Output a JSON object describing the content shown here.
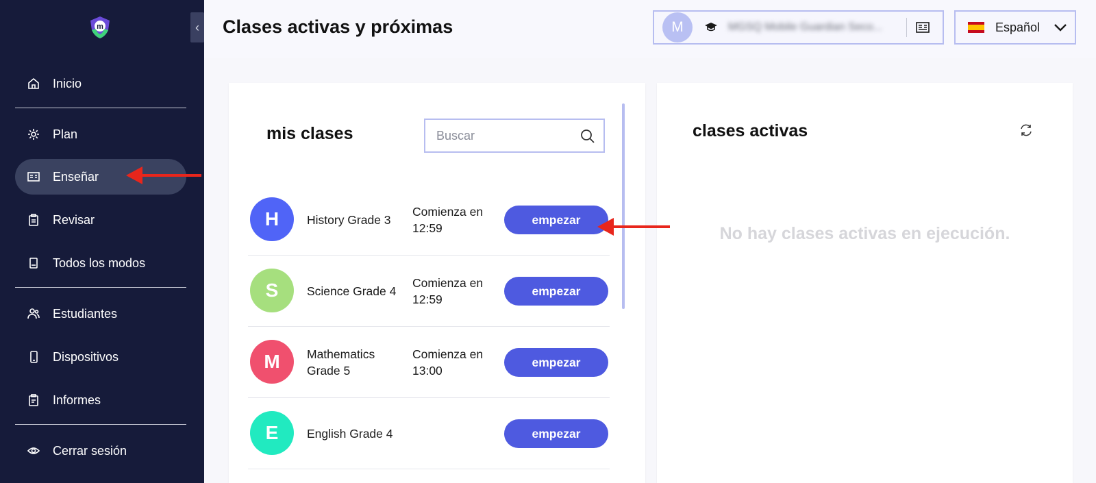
{
  "header": {
    "title": "Clases activas y próximas",
    "user": {
      "avatar_letter": "M",
      "school": "MGSQ Mobile Guardian Seco...",
      "cap_icon": "graduation-cap-icon",
      "id_icon": "id-card-icon"
    },
    "language": {
      "label": "Español",
      "flag": "spain-flag",
      "chevron": "chevron-down-icon"
    }
  },
  "sidebar": {
    "collapse_icon": "‹",
    "items": [
      {
        "label": "Inicio",
        "icon": "home-icon"
      },
      {
        "label": "Plan",
        "icon": "gear-icon"
      },
      {
        "label": "Enseñar",
        "icon": "teach-board-icon",
        "active": true
      },
      {
        "label": "Revisar",
        "icon": "clipboard-icon"
      },
      {
        "label": "Todos los modos",
        "icon": "document-icon"
      },
      {
        "label": "Estudiantes",
        "icon": "students-icon"
      },
      {
        "label": "Dispositivos",
        "icon": "phone-icon"
      },
      {
        "label": "Informes",
        "icon": "report-icon"
      },
      {
        "label": "Cerrar sesión",
        "icon": "eye-icon"
      }
    ]
  },
  "my_classes": {
    "title": "mis clases",
    "search_placeholder": "Buscar",
    "classes": [
      {
        "letter": "H",
        "name": "History Grade 3",
        "start": "Comienza en 12:59",
        "button": "empezar",
        "color": "#5064f7"
      },
      {
        "letter": "S",
        "name": "Science Grade 4",
        "start": "Comienza en 12:59",
        "button": "empezar",
        "color": "#a6df7e"
      },
      {
        "letter": "M",
        "name": "Mathematics Grade 5",
        "start": "Comienza en 13:00",
        "button": "empezar",
        "color": "#f0506e"
      },
      {
        "letter": "E",
        "name": "English Grade 4",
        "start": "",
        "button": "empezar",
        "color": "#21eac0"
      }
    ]
  },
  "active_classes": {
    "title": "clases activas",
    "empty_message": "No hay clases activas en ejecución.",
    "refresh_icon": "refresh-icon"
  },
  "colors": {
    "sidebar": "#161b3a",
    "accent": "#4e5ae0",
    "arrow": "#e8261c"
  }
}
